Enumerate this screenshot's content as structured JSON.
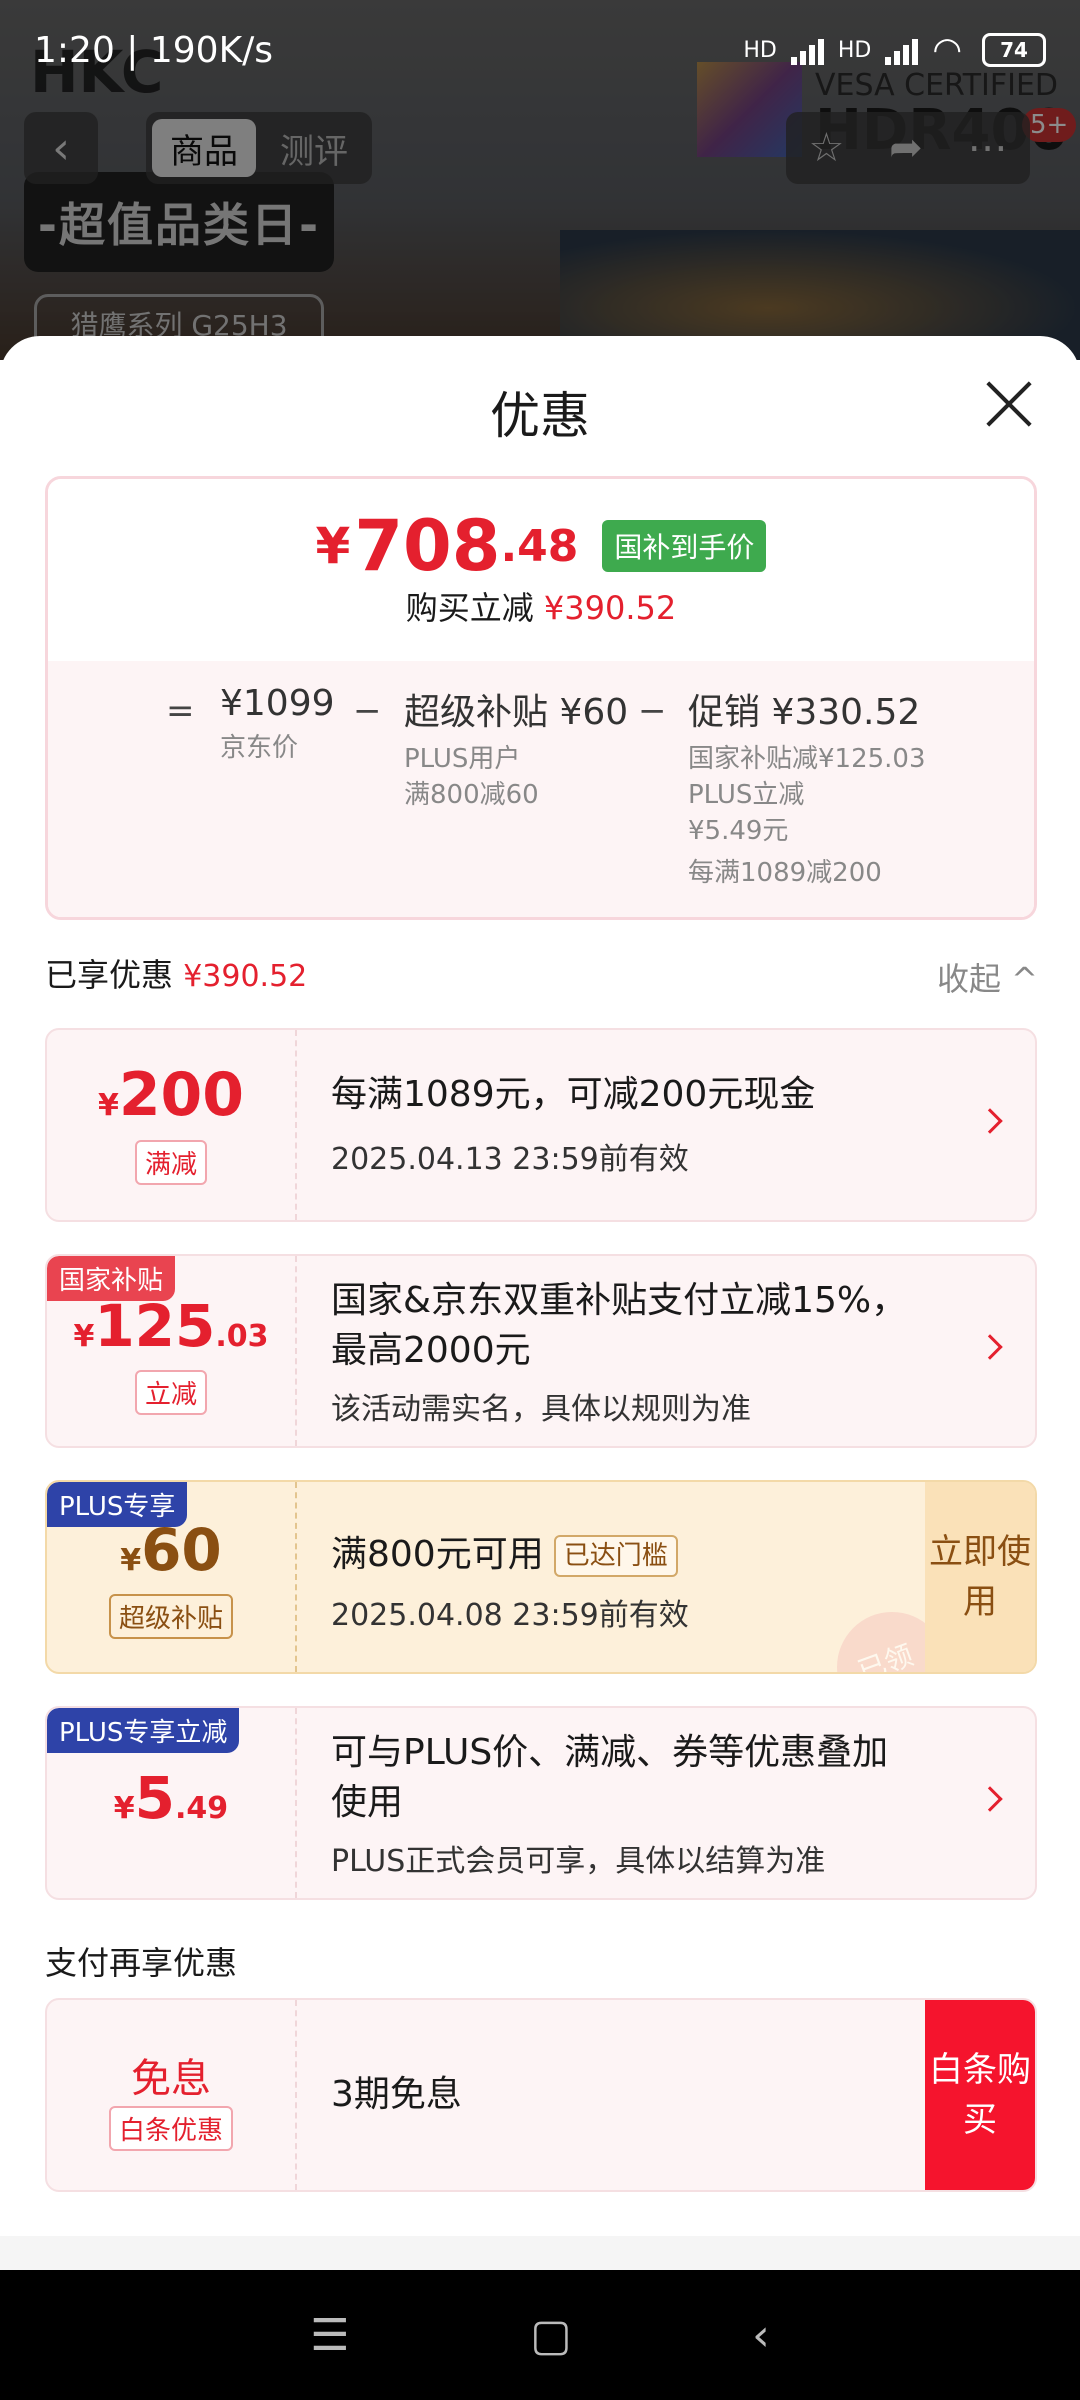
{
  "status": {
    "time": "1:20",
    "speed": "190K/s",
    "hd1": "HD",
    "hd2": "HD",
    "battery": "74"
  },
  "background": {
    "brand": "HKC",
    "vesa": "VESA CERTIFIED",
    "hdr": "HDR400",
    "badge": "5+",
    "promo_title": "-超值品类日-",
    "promo_sub": "猎鹰系列 G25H3"
  },
  "nav": {
    "tabs": [
      "商品",
      "测评"
    ],
    "active_tab": "商品"
  },
  "sheet": {
    "title": "优惠",
    "price": {
      "yen": "¥",
      "int": "708",
      "dec": ".48",
      "tag": "国补到手价",
      "reduce_label": "购买立减",
      "reduce_value": "¥390.52"
    },
    "breakdown": {
      "eq1": "=",
      "jd_price": "¥1099",
      "jd_label": "京东价",
      "minus1": "−",
      "subsidy": "超级补贴 ¥60",
      "subsidy_l1": "PLUS用户",
      "subsidy_l2": "满800减60",
      "minus2": "−",
      "promo": "促销 ¥330.52",
      "promo_l1": "国家补贴减¥125.03",
      "promo_l2": "PLUS立减",
      "promo_l3": "¥5.49元",
      "promo_l4": "每满1089减200"
    },
    "enjoyed_label": "已享优惠",
    "enjoyed_value": "¥390.52",
    "fold": "收起 ^",
    "cards": [
      {
        "yen": "¥",
        "amt": "200",
        "dec": "",
        "chip": "满减",
        "desc": "每满1089元，可减200元现金",
        "sub": "2025.04.13 23:59前有效"
      },
      {
        "flag": "国家补贴",
        "yen": "¥",
        "amt": "125",
        "dec": ".03",
        "chip": "立减",
        "desc": "国家&京东双重补贴支付立减15%，最高2000元",
        "sub": "该活动需实名，具体以规则为准"
      },
      {
        "flag": "PLUS专享",
        "yen": "¥",
        "amt": "60",
        "dec": "",
        "chip": "超级补贴",
        "desc": "满800元可用",
        "reached": "已达门槛",
        "sub": "2025.04.08 23:59前有效",
        "btn": "立即使用",
        "stamp": "已领"
      },
      {
        "flag": "PLUS专享立减",
        "yen": "¥",
        "amt": "5",
        "dec": ".49",
        "desc": "可与PLUS价、满减、券等优惠叠加使用",
        "sub": "PLUS正式会员可享，具体以结算为准"
      }
    ],
    "pay_title": "支付再享优惠",
    "pay_card": {
      "title": "免息",
      "chip": "白条优惠",
      "desc": "3期免息",
      "btn": "白条购买"
    }
  },
  "colors": {
    "accent": "#e4202e",
    "green": "#3eaa4e",
    "plus_blue": "#2e43a8",
    "gold": "#8a4f12"
  }
}
